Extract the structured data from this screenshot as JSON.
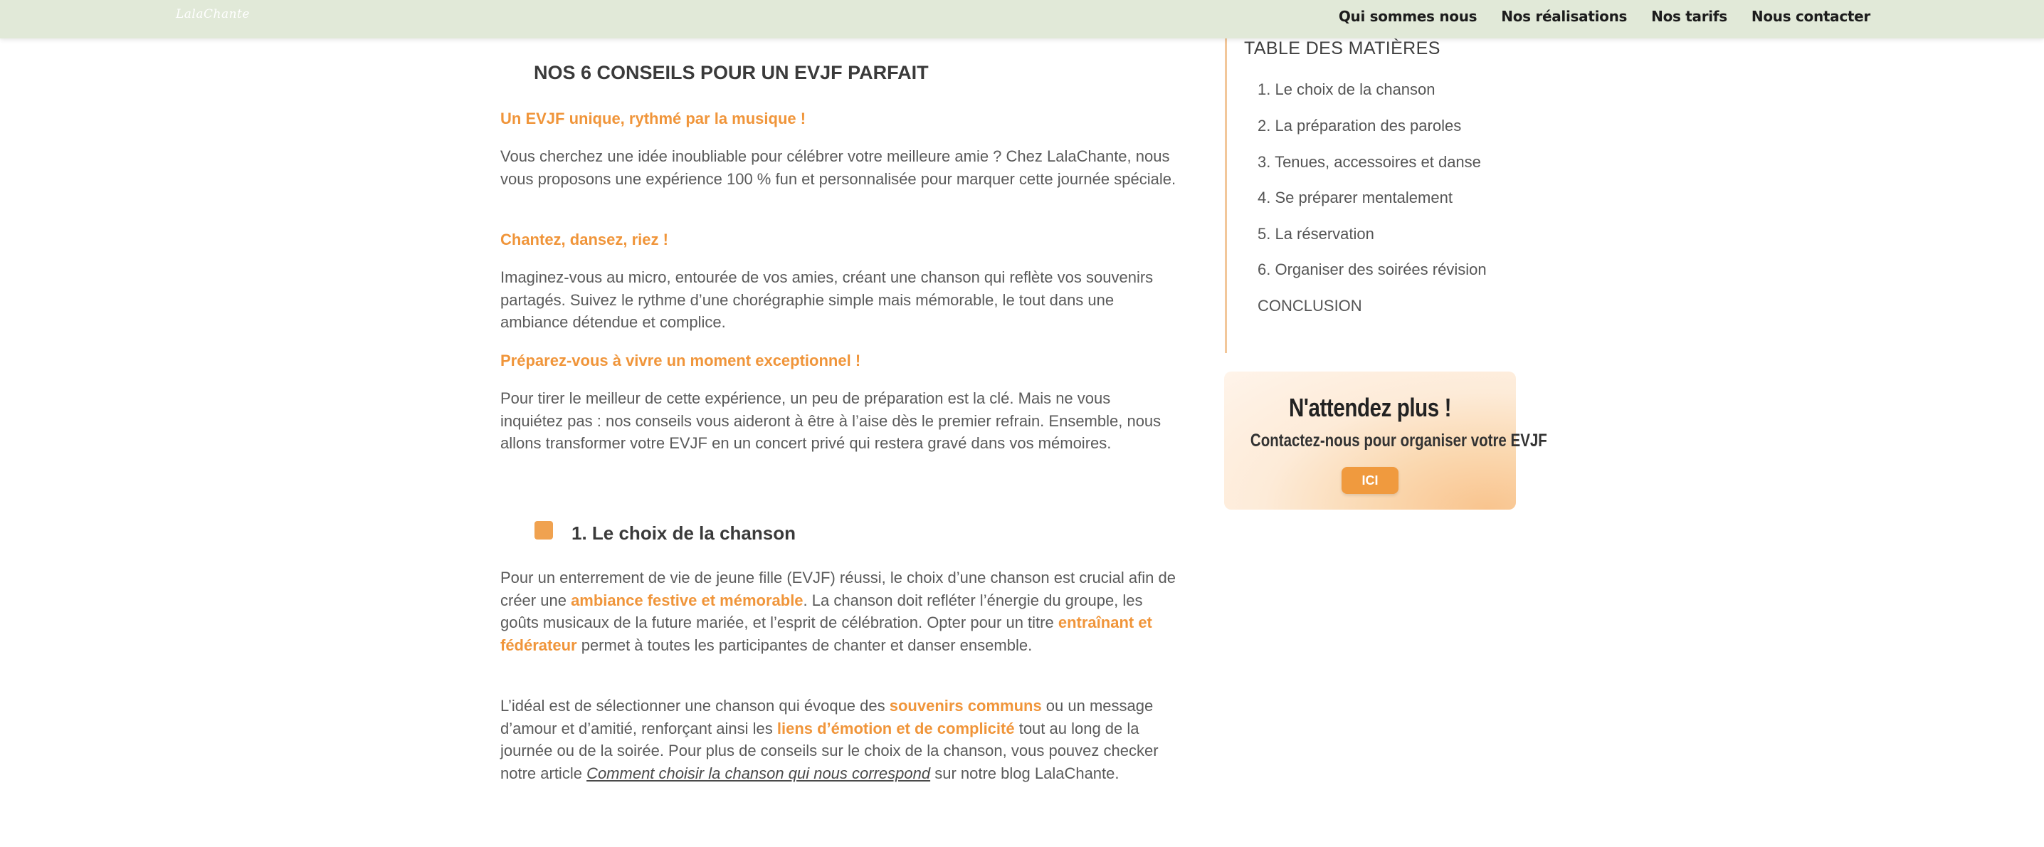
{
  "header": {
    "logo_text": "LalaChante",
    "nav": [
      {
        "label": "Qui sommes nous"
      },
      {
        "label": "Nos réalisations"
      },
      {
        "label": "Nos tarifs"
      },
      {
        "label": "Nous contacter"
      }
    ]
  },
  "article": {
    "title": "NOS 6 CONSEILS POUR UN EVJF PARFAIT",
    "intro_heading": "Un EVJF unique, rythmé par la musique !",
    "intro_text": "Vous cherchez une idée inoubliable pour célébrer votre meilleure amie ? Chez LalaChante, nous vous proposons une expérience 100 % fun et personnalisée pour marquer cette journée spéciale.",
    "heading_2": "Chantez, dansez, riez !",
    "text_2": "Imaginez-vous au micro, entourée de vos amies, créant une chanson qui reflète vos souvenirs partagés. Suivez le rythme d’une chorégraphie simple mais mémorable, le tout dans une ambiance détendue et complice.",
    "heading_3": "Préparez-vous à vivre un moment exceptionnel !",
    "text_3": "Pour tirer le meilleur de cette expérience, un peu de préparation est la clé. Mais ne vous inquiétez pas : nos conseils vous aideront à être à l’aise dès le premier refrain. Ensemble, nous allons transformer votre EVJF en un concert privé qui restera gravé dans vos mémoires.",
    "section_1": {
      "title": "1. Le choix de la chanson",
      "p1": {
        "a": "Pour un enterrement de vie de jeune fille (EVJF) réussi, le choix d’une chanson est crucial afin de créer une ",
        "b": "ambiance festive et mémorable",
        "c": ". La chanson doit refléter l’énergie du groupe, les goûts musicaux de la future mariée, et l’esprit de célébration. Opter pour un titre ",
        "d": "entraînant et fédérateur",
        "e": " permet à toutes les participantes de chanter et danser ensemble."
      },
      "p2": {
        "a": "L’idéal est de sélectionner une chanson qui évoque des ",
        "b": "souvenirs communs",
        "c": " ou un message d’amour et d’amitié, renforçant ainsi les ",
        "d": "liens d’émotion et de complicité",
        "e": " tout au long de la journée ou de la soirée. Pour plus de conseils sur le choix de la chanson, vous pouvez checker notre article ",
        "link": "Comment choisir la chanson qui nous correspond",
        "f": " sur notre blog LalaChante."
      }
    }
  },
  "toc": {
    "title": "TABLE DES MATIÈRES",
    "items": [
      {
        "label": "1. Le choix de la chanson"
      },
      {
        "label": "2. La préparation des paroles"
      },
      {
        "label": "3. Tenues, accessoires et danse"
      },
      {
        "label": "4. Se préparer mentalement"
      },
      {
        "label": "5. La réservation"
      },
      {
        "label": "6. Organiser des soirées révision"
      },
      {
        "label": "CONCLUSION"
      }
    ]
  },
  "cta": {
    "title": "N'attendez plus !",
    "subtitle": "Contactez-nous pour organiser votre EVJF",
    "button_label": "ICI"
  },
  "colors": {
    "header_bg": "#e1e9d8",
    "accent_orange": "#f0953a",
    "text": "#5a5a5a",
    "heading": "#3a3a3a",
    "toc_border": "#f2c79a"
  }
}
